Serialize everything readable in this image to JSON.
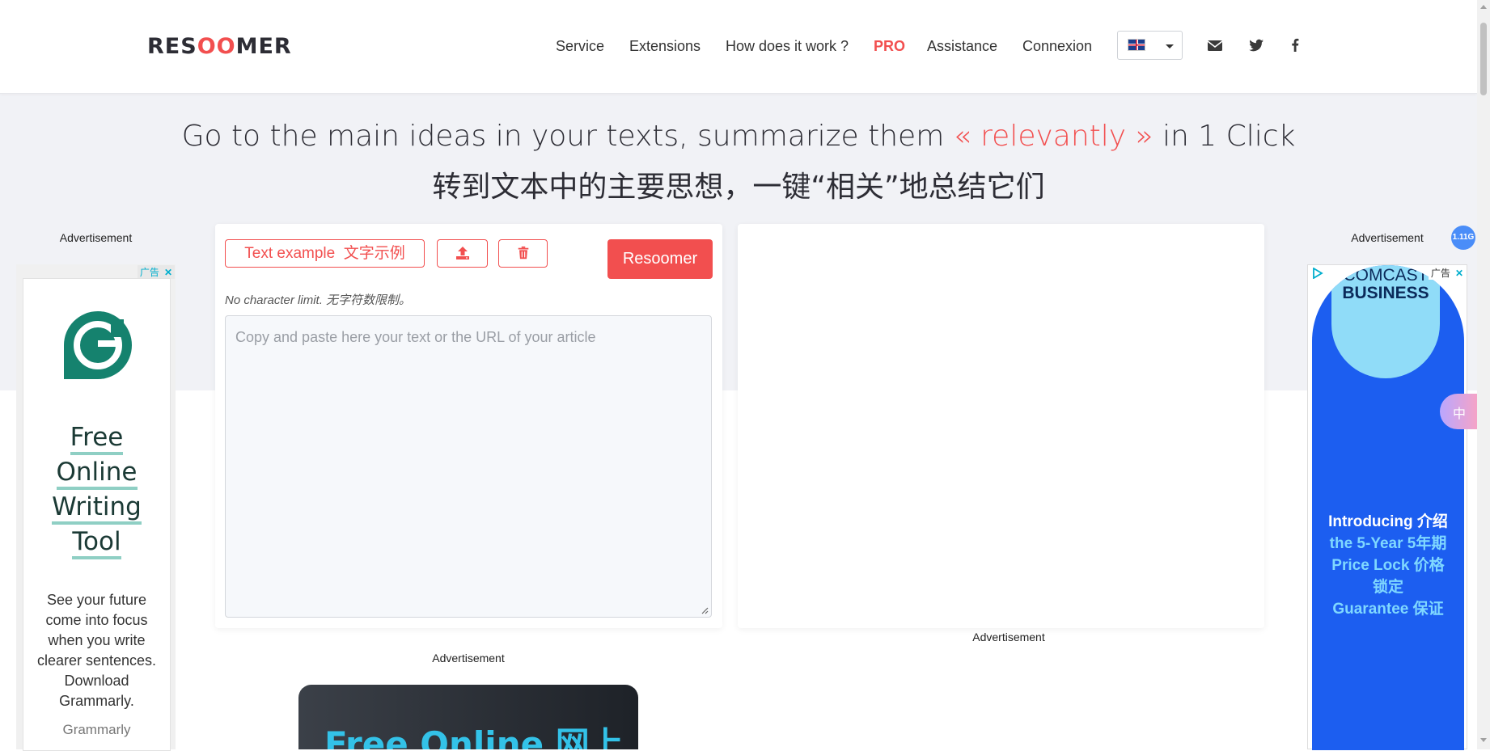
{
  "header": {
    "logo": {
      "pre": "RES",
      "oo": "OO",
      "post": "MER"
    },
    "nav": [
      {
        "label": "Service"
      },
      {
        "label": "Extensions"
      },
      {
        "label": "How does it work ?"
      },
      {
        "label": "PRO"
      },
      {
        "label": "Assistance"
      },
      {
        "label": "Connexion"
      }
    ],
    "language_icon": "uk-flag-icon",
    "social_icons": [
      "envelope-icon",
      "twitter-icon",
      "facebook-icon"
    ]
  },
  "hero": {
    "line1_pre": "Go to the main ideas in your texts, summarize them ",
    "line1_highlight": "« relevantly »",
    "line1_post": " in 1 Click",
    "line2": "转到文本中的主要思想，一键“相关”地总结它们"
  },
  "editor": {
    "example_button": "Text example  文字示例",
    "upload_icon": "upload-icon",
    "trash_icon": "trash-icon",
    "submit_button": "Resoomer",
    "note": "No character limit. 无字符数限制。",
    "placeholder": "Copy and paste here your text or the URL of your article"
  },
  "ads": {
    "label": "Advertisement",
    "left": {
      "chip": "广告",
      "headline": [
        "Free",
        "Online",
        "Writing",
        "Tool"
      ],
      "body": [
        "See your future",
        "come into focus",
        "when you write",
        "clearer sentences.",
        "Download",
        "Grammarly."
      ],
      "brand": "Grammarly"
    },
    "right": {
      "chip": "广告",
      "brand_line1": "COMCAST",
      "brand_line2": "BUSINESS",
      "copy": [
        "Introducing 介绍",
        "the 5-Year 5年期",
        "Price Lock 价格",
        "锁定",
        "Guarantee 保证"
      ]
    },
    "bottom": {
      "text": "Free Online 网上"
    }
  },
  "overlay": {
    "badge": "1.11G",
    "tool": "中"
  },
  "colors": {
    "accent": "#f24f4f",
    "text": "#2d2d35",
    "band": "#f1f2f6"
  }
}
